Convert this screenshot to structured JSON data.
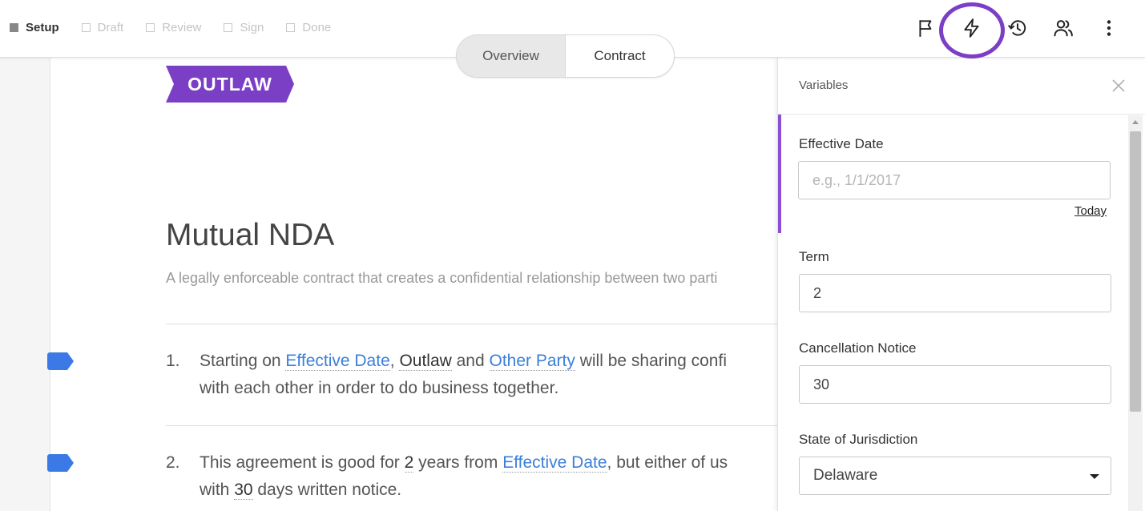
{
  "steps": [
    {
      "label": "Setup",
      "state": "active"
    },
    {
      "label": "Draft",
      "state": "inactive"
    },
    {
      "label": "Review",
      "state": "inactive"
    },
    {
      "label": "Sign",
      "state": "inactive"
    },
    {
      "label": "Done",
      "state": "inactive"
    }
  ],
  "view_toggle": {
    "overview": "Overview",
    "contract": "Contract",
    "selected": "contract"
  },
  "toolbar_icons": [
    "flag-icon",
    "lightning-icon",
    "history-icon",
    "users-icon",
    "more-vertical-icon"
  ],
  "colors": {
    "brand": "#7b3fc6",
    "link": "#3b7fd9",
    "tag": "#3b7ae6",
    "highlight": "#7b3fc6"
  },
  "document": {
    "logo": "OUTLAW",
    "title": "Mutual NDA",
    "subtitle": "A legally enforceable contract that creates a confidential relationship between two parti",
    "clauses": [
      {
        "number": "1.",
        "t1": "Starting on ",
        "v1": "Effective Date",
        "t2": ", ",
        "v2": "Outlaw",
        "t3": " and ",
        "v3": "Other Party",
        "t4": " will be sharing confi",
        "line2": "with each other in order to do business together."
      },
      {
        "number": "2.",
        "t1": "This agreement is good for ",
        "v1": "2",
        "t2": " years from ",
        "v2": "Effective Date",
        "t3": ", but either of us",
        "l2a": "with ",
        "l2v": "30",
        "l2b": " days written notice."
      }
    ]
  },
  "panel": {
    "title": "Variables",
    "fields": [
      {
        "label": "Effective Date",
        "value": "",
        "placeholder": "e.g., 1/1/2017",
        "helper": "Today"
      },
      {
        "label": "Term",
        "value": "2"
      },
      {
        "label": "Cancellation Notice",
        "value": "30"
      },
      {
        "label": "State of Jurisdiction",
        "value": "Delaware"
      }
    ]
  }
}
